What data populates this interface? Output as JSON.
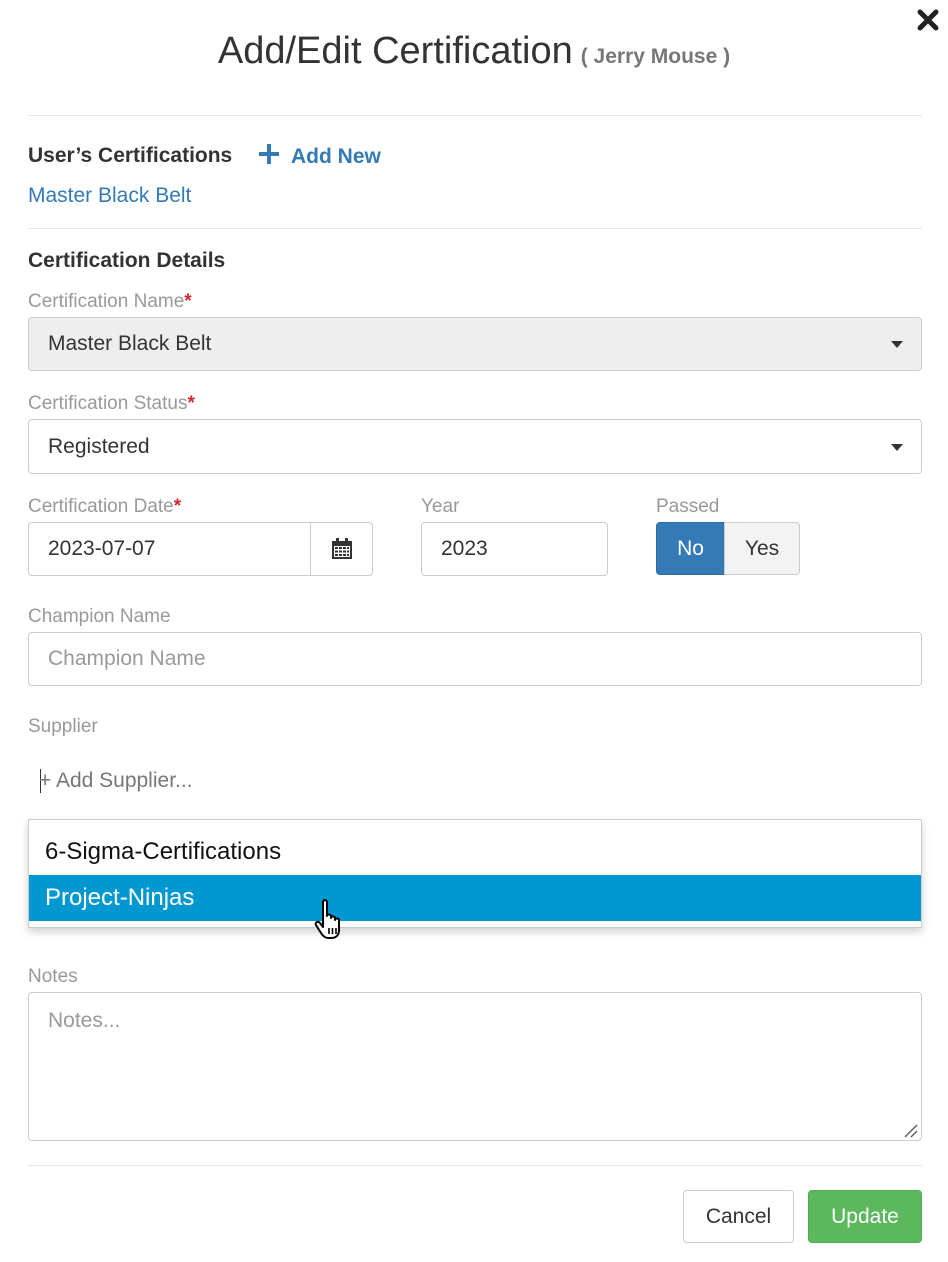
{
  "modal": {
    "title": "Add/Edit Certification",
    "subtitle": "( Jerry Mouse )"
  },
  "users_certifications": {
    "heading": "User’s Certifications",
    "add_new_label": "Add New",
    "items": [
      "Master Black Belt"
    ]
  },
  "details": {
    "heading": "Certification Details",
    "cert_name": {
      "label": "Certification Name",
      "value": "Master Black Belt"
    },
    "cert_status": {
      "label": "Certification Status",
      "value": "Registered"
    },
    "cert_date": {
      "label": "Certification Date",
      "value": "2023-07-07"
    },
    "year": {
      "label": "Year",
      "value": "2023"
    },
    "passed": {
      "label": "Passed",
      "no_label": "No",
      "yes_label": "Yes",
      "selected": "No"
    },
    "required_marker": "*",
    "champion": {
      "label": "Champion Name",
      "placeholder": "Champion Name"
    },
    "supplier": {
      "label": "Supplier",
      "input_placeholder": "+ Add Supplier...",
      "options": [
        "6-Sigma-Certifications",
        "Project-Ninjas"
      ],
      "highlighted": "Project-Ninjas"
    },
    "notes": {
      "label": "Notes",
      "placeholder": "Notes..."
    }
  },
  "footer": {
    "cancel_label": "Cancel",
    "update_label": "Update"
  },
  "colors": {
    "primary": "#337ab7",
    "success": "#5cb85c",
    "highlight": "#0198d1",
    "required": "#d9262b"
  }
}
